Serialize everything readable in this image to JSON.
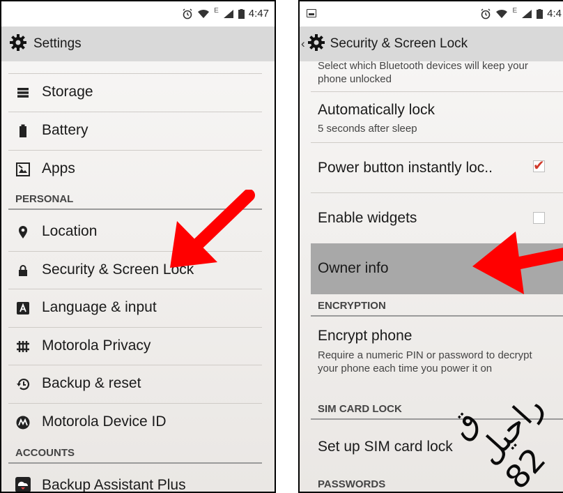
{
  "left": {
    "status_time": "4:47",
    "status_network": "E",
    "title": "Settings",
    "items_top": [
      {
        "label": "Storage",
        "icon": "storage-icon"
      },
      {
        "label": "Battery",
        "icon": "battery-icon"
      },
      {
        "label": "Apps",
        "icon": "apps-icon"
      }
    ],
    "section_personal": "PERSONAL",
    "items_personal": [
      {
        "label": "Location",
        "icon": "location-icon"
      },
      {
        "label": "Security & Screen Lock",
        "icon": "lock-icon"
      },
      {
        "label": "Language & input",
        "icon": "language-icon"
      },
      {
        "label": "Motorola Privacy",
        "icon": "privacy-icon"
      },
      {
        "label": "Backup & reset",
        "icon": "backup-icon"
      },
      {
        "label": "Motorola Device ID",
        "icon": "motorola-icon"
      }
    ],
    "section_accounts": "ACCOUNTS",
    "items_accounts": [
      {
        "label": "Backup Assistant Plus",
        "icon": "backup-assistant-icon"
      }
    ]
  },
  "right": {
    "status_time": "4:4",
    "status_network": "E",
    "title": "Security & Screen Lock",
    "bluetooth_subtitle": "Select which Bluetooth devices will keep your phone unlocked",
    "auto_lock": {
      "title": "Automatically lock",
      "subtitle": "5 seconds after sleep"
    },
    "power_button": {
      "title": "Power button instantly loc..",
      "checked": true
    },
    "enable_widgets": {
      "title": "Enable widgets",
      "checked": false
    },
    "owner_info": {
      "title": "Owner info"
    },
    "section_encryption": "ENCRYPTION",
    "encrypt_phone": {
      "title": "Encrypt phone",
      "subtitle": "Require a numeric PIN or password to decrypt your phone each time you power it on"
    },
    "section_sim": "SIM CARD LOCK",
    "sim_lock": {
      "title": "Set up SIM card lock"
    },
    "section_passwords": "PASSWORDS"
  },
  "colors": {
    "arrow": "#ff0000",
    "highlight": "#a8a8a8",
    "checkmark": "#d03a2b",
    "actionbar": "#d9d9d9"
  },
  "watermark": "ق راحیل 82"
}
